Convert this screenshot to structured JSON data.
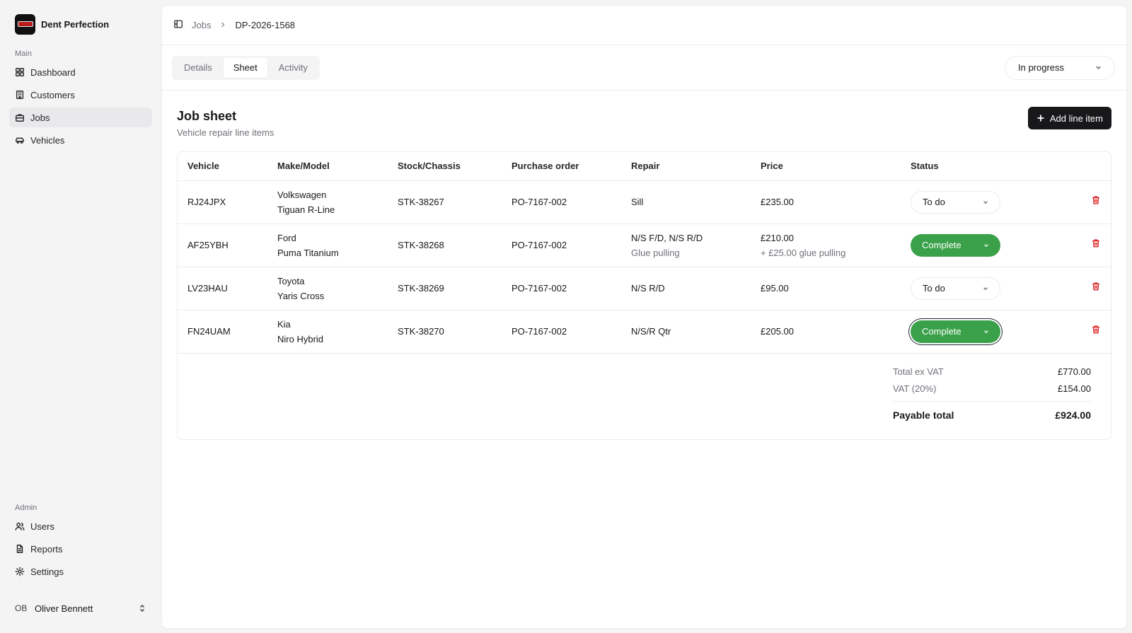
{
  "app": {
    "name": "Dent Perfection"
  },
  "sidebar": {
    "main_label": "Main",
    "main_items": [
      {
        "label": "Dashboard",
        "icon": "dashboard-icon"
      },
      {
        "label": "Customers",
        "icon": "building-icon"
      },
      {
        "label": "Jobs",
        "icon": "briefcase-icon",
        "active": true
      },
      {
        "label": "Vehicles",
        "icon": "car-icon"
      }
    ],
    "admin_label": "Admin",
    "admin_items": [
      {
        "label": "Users",
        "icon": "users-icon"
      },
      {
        "label": "Reports",
        "icon": "file-icon"
      },
      {
        "label": "Settings",
        "icon": "gear-icon"
      }
    ],
    "user": {
      "initials": "OB",
      "name": "Oliver Bennett"
    }
  },
  "breadcrumb": {
    "parent": "Jobs",
    "current": "DP-2026-1568"
  },
  "tabs": [
    {
      "label": "Details"
    },
    {
      "label": "Sheet",
      "active": true
    },
    {
      "label": "Activity"
    }
  ],
  "job_status": "In progress",
  "sheet": {
    "title": "Job sheet",
    "subtitle": "Vehicle repair line items",
    "add_label": "Add line item"
  },
  "table": {
    "columns": [
      "Vehicle",
      "Make/Model",
      "Stock/Chassis",
      "Purchase order",
      "Repair",
      "Price",
      "Status"
    ],
    "rows": [
      {
        "vehicle": "RJ24JPX",
        "make": "Volkswagen",
        "model": "Tiguan R-Line",
        "stock": "STK-38267",
        "po": "PO-7167-002",
        "repair": "Sill",
        "repair_note": "",
        "price": "£235.00",
        "price_note": "",
        "status": "To do"
      },
      {
        "vehicle": "AF25YBH",
        "make": "Ford",
        "model": "Puma Titanium",
        "stock": "STK-38268",
        "po": "PO-7167-002",
        "repair": "N/S F/D, N/S R/D",
        "repair_note": "Glue pulling",
        "price": "£210.00",
        "price_note": "+ £25.00 glue pulling",
        "status": "Complete"
      },
      {
        "vehicle": "LV23HAU",
        "make": "Toyota",
        "model": "Yaris Cross",
        "stock": "STK-38269",
        "po": "PO-7167-002",
        "repair": "N/S R/D",
        "repair_note": "",
        "price": "£95.00",
        "price_note": "",
        "status": "To do"
      },
      {
        "vehicle": "FN24UAM",
        "make": "Kia",
        "model": "Niro Hybrid",
        "stock": "STK-38270",
        "po": "PO-7167-002",
        "repair": "N/S/R Qtr",
        "repair_note": "",
        "price": "£205.00",
        "price_note": "",
        "status": "Complete"
      }
    ]
  },
  "totals": {
    "ex_vat_label": "Total ex VAT",
    "ex_vat": "£770.00",
    "vat_label": "VAT (20%)",
    "vat": "£154.00",
    "payable_label": "Payable total",
    "payable": "£924.00"
  },
  "colors": {
    "complete": "#3aa14a",
    "danger": "#dc2626",
    "primary": "#18181b"
  }
}
